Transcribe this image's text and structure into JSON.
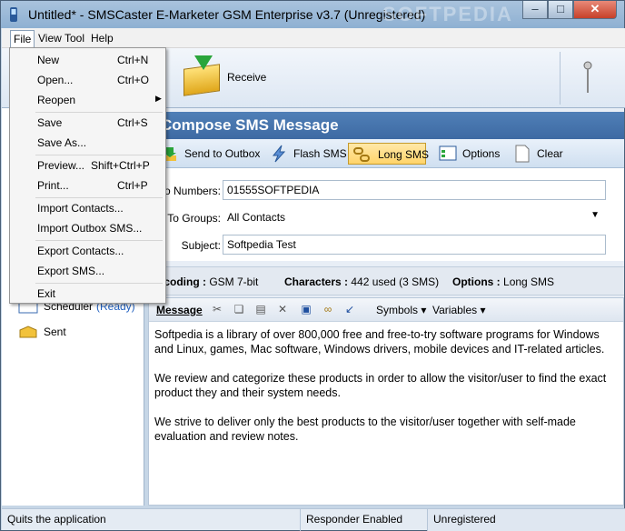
{
  "window": {
    "title": "Untitled* - SMSCaster E-Marketer GSM Enterprise v3.7 (Unregistered)",
    "watermark": "SOFTPEDIA"
  },
  "menubar": [
    "File",
    "View",
    "Tool",
    "Help"
  ],
  "toolbar": {
    "receive_label": "Receive"
  },
  "file_menu": [
    {
      "label": "New",
      "shortcut": "Ctrl+N"
    },
    {
      "label": "Open...",
      "shortcut": "Ctrl+O"
    },
    {
      "label": "Reopen",
      "shortcut": ""
    },
    {
      "label": "Save",
      "shortcut": "Ctrl+S"
    },
    {
      "label": "Save As...",
      "shortcut": ""
    },
    {
      "label": "Preview...",
      "shortcut": "Shift+Ctrl+P"
    },
    {
      "label": "Print...",
      "shortcut": "Ctrl+P"
    },
    {
      "label": "Import Contacts...",
      "shortcut": ""
    },
    {
      "label": "Import Outbox SMS...",
      "shortcut": ""
    },
    {
      "label": "Export Contacts...",
      "shortcut": ""
    },
    {
      "label": "Export SMS...",
      "shortcut": ""
    },
    {
      "label": "Exit",
      "shortcut": ""
    }
  ],
  "nav": {
    "scheduler": "Scheduler",
    "scheduler_status": "(Ready)",
    "sent": "Sent"
  },
  "compose": {
    "heading": "Compose SMS Message"
  },
  "actions": {
    "send_outbox": "Send to Outbox",
    "flash": "Flash SMS",
    "long": "Long SMS",
    "options": "Options",
    "clear": "Clear"
  },
  "form": {
    "numbers_label": "To Numbers:",
    "numbers_value": "01555SOFTPEDIA",
    "groups_label": "To Groups:",
    "groups_value": "All Contacts",
    "subject_label": "Subject:",
    "subject_value": "Softpedia Test"
  },
  "info": {
    "encoding_label": "Encoding :",
    "encoding_value": "GSM 7-bit",
    "chars_label": "Characters :",
    "chars_value": "442 used (3 SMS)",
    "options_label": "Options :",
    "options_value": "Long SMS"
  },
  "message": {
    "label": "Message",
    "symbols": "Symbols",
    "variables": "Variables",
    "text": "Softpedia is a library of over 800,000 free and free-to-try software programs for Windows and Linux, games, Mac software, Windows drivers, mobile devices and IT-related articles.\n\nWe review and categorize these products in order to allow the visitor/user to find the exact product they and their system needs.\n\nWe strive to deliver only the best products to the visitor/user together with self-made evaluation and review notes."
  },
  "status": {
    "hint": "Quits the application",
    "responder": "Responder Enabled",
    "reg": "Unregistered"
  },
  "colors": {
    "header": "#3e6aa3",
    "accent": "#ffd46a"
  }
}
